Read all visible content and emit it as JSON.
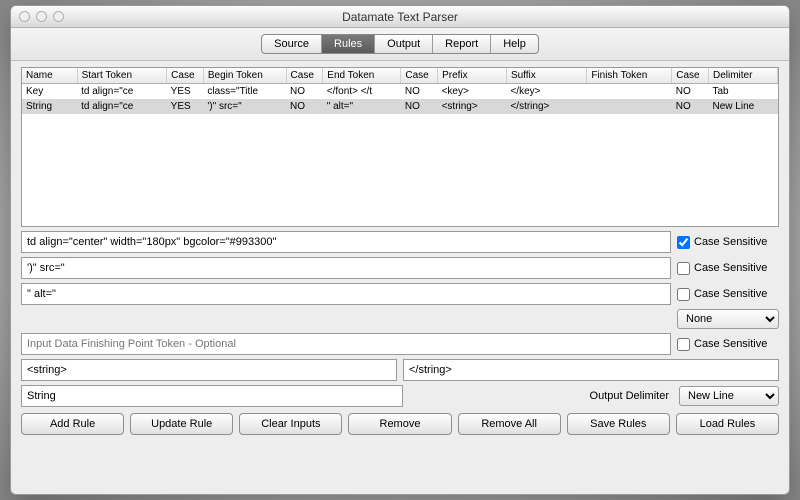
{
  "window": {
    "title": "Datamate Text Parser"
  },
  "tabs": [
    "Source",
    "Rules",
    "Output",
    "Report",
    "Help"
  ],
  "active_tab": 1,
  "columns": [
    "Name",
    "Start Token",
    "Case",
    "Begin Token",
    "Case",
    "End Token",
    "Case",
    "Prefix",
    "Suffix",
    "Finish Token",
    "Case",
    "Delimiter"
  ],
  "rows": [
    {
      "c": [
        "Key",
        "td align=\"ce",
        "YES",
        "class=\"Title",
        "NO",
        "</font> </t",
        "NO",
        "<key>",
        "</key>",
        "",
        "NO",
        "Tab"
      ]
    },
    {
      "c": [
        "String",
        "td align=\"ce",
        "YES",
        "')\" src=\"",
        "NO",
        "\" alt=\"",
        "NO",
        "<string>",
        "</string>",
        "",
        "NO",
        "New Line"
      ]
    }
  ],
  "fields": {
    "start_token": "td align=\"center\" width=\"180px\" bgcolor=\"#993300\"",
    "begin_token": "')\" src=\"",
    "end_token": "\" alt=\"",
    "finish_placeholder": "Input Data Finishing Point Token - Optional",
    "prefix": "<string>",
    "suffix": "</string>",
    "name": "String"
  },
  "cs_label": "Case Sensitive",
  "cs": {
    "start": true,
    "begin": false,
    "end": false,
    "finish": false
  },
  "none_option": "None",
  "output_delim_label": "Output Delimiter",
  "output_delim_value": "New Line",
  "buttons": {
    "add": "Add Rule",
    "update": "Update Rule",
    "clear": "Clear Inputs",
    "remove": "Remove",
    "remove_all": "Remove All",
    "save": "Save Rules",
    "load": "Load Rules"
  }
}
